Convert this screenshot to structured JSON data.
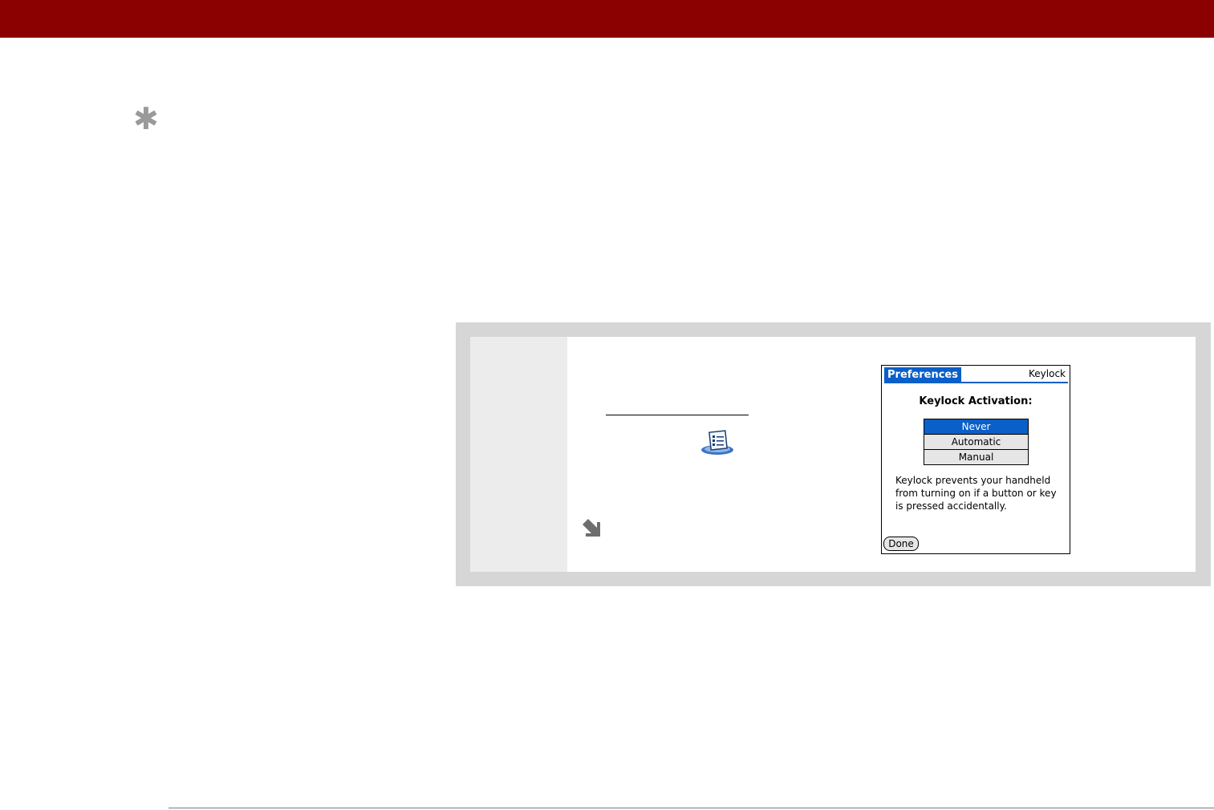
{
  "colors": {
    "header_bar": "#8b0000",
    "panel_border": "#d6d6d6",
    "step_column": "#ececec",
    "palm_blue": "#0a5fc8",
    "tip_star": "#9a9a9a"
  },
  "tip": {
    "icon": "asterisk-tip-icon"
  },
  "step": {
    "app_icon": "prefs-app-icon",
    "continue_icon": "arrow-down-right-icon"
  },
  "device": {
    "app_title": "Preferences",
    "panel_name": "Keylock",
    "heading": "Keylock Activation:",
    "options": [
      {
        "label": "Never",
        "selected": true
      },
      {
        "label": "Automatic",
        "selected": false
      },
      {
        "label": "Manual",
        "selected": false
      }
    ],
    "description": "Keylock prevents your handheld from turning on if a button or key is pressed accidentally.",
    "done_label": "Done"
  }
}
